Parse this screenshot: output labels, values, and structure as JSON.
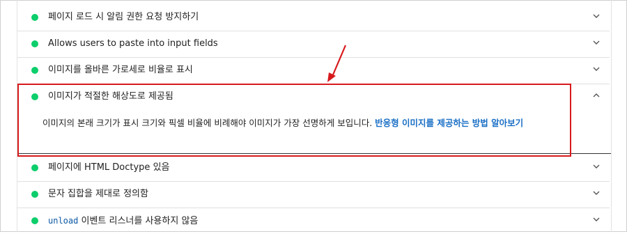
{
  "audits": [
    {
      "title": "페이지 로드 시 알림 권한 요청 방지하기",
      "expanded": false
    },
    {
      "title": "Allows users to paste into input fields",
      "expanded": false
    },
    {
      "title": "이미지를 올바른 가로세로 비율로 표시",
      "expanded": false
    },
    {
      "title": "이미지가 적절한 해상도로 제공됨",
      "expanded": true,
      "description": "이미지의 본래 크기가 표시 크기와 픽셀 비율에 비례해야 이미지가 가장 선명하게 보입니다.",
      "link_text": "반응형 이미지를 제공하는 방법 알아보기"
    },
    {
      "title": "페이지에 HTML Doctype 있음",
      "expanded": false
    },
    {
      "title": "문자 집합을 제대로 정의함",
      "expanded": false
    },
    {
      "title_code": "unload",
      "title": " 이벤트 리스너를 사용하지 않음",
      "expanded": false
    }
  ],
  "colors": {
    "pass": "#0cce6b",
    "highlight": "#d7191c",
    "link": "#1a6fc6"
  },
  "icons": {
    "status": "pass-dot-icon",
    "collapsed": "chevron-down-icon",
    "expanded": "chevron-up-icon",
    "annotation": "red-arrow-icon"
  }
}
